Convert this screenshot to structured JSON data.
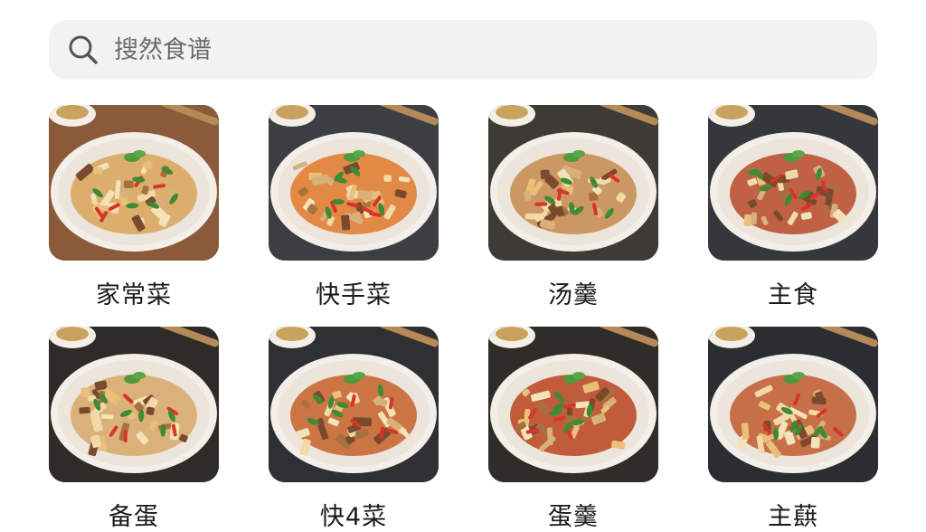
{
  "search": {
    "placeholder": "搜然食谱",
    "icon": "search-icon"
  },
  "categories": [
    {
      "label": "家常菜",
      "table_color": "#8a5a3a",
      "sauce": "#d9a45a"
    },
    {
      "label": "快手菜",
      "table_color": "#3b3f44",
      "sauce": "#e07a2a"
    },
    {
      "label": "汤羹",
      "table_color": "#3e3a36",
      "sauce": "#c6894e"
    },
    {
      "label": "主食",
      "table_color": "#34383d",
      "sauce": "#b94a2a"
    },
    {
      "label": "备蛋",
      "table_color": "#2f2b28",
      "sauce": "#d8a868"
    },
    {
      "label": "快4菜",
      "table_color": "#2e3034",
      "sauce": "#c5622a"
    },
    {
      "label": "蛋羹",
      "table_color": "#2f2c2a",
      "sauce": "#b8431f"
    },
    {
      "label": "主蕻",
      "table_color": "#2a2d32",
      "sauce": "#c05a2e"
    }
  ]
}
